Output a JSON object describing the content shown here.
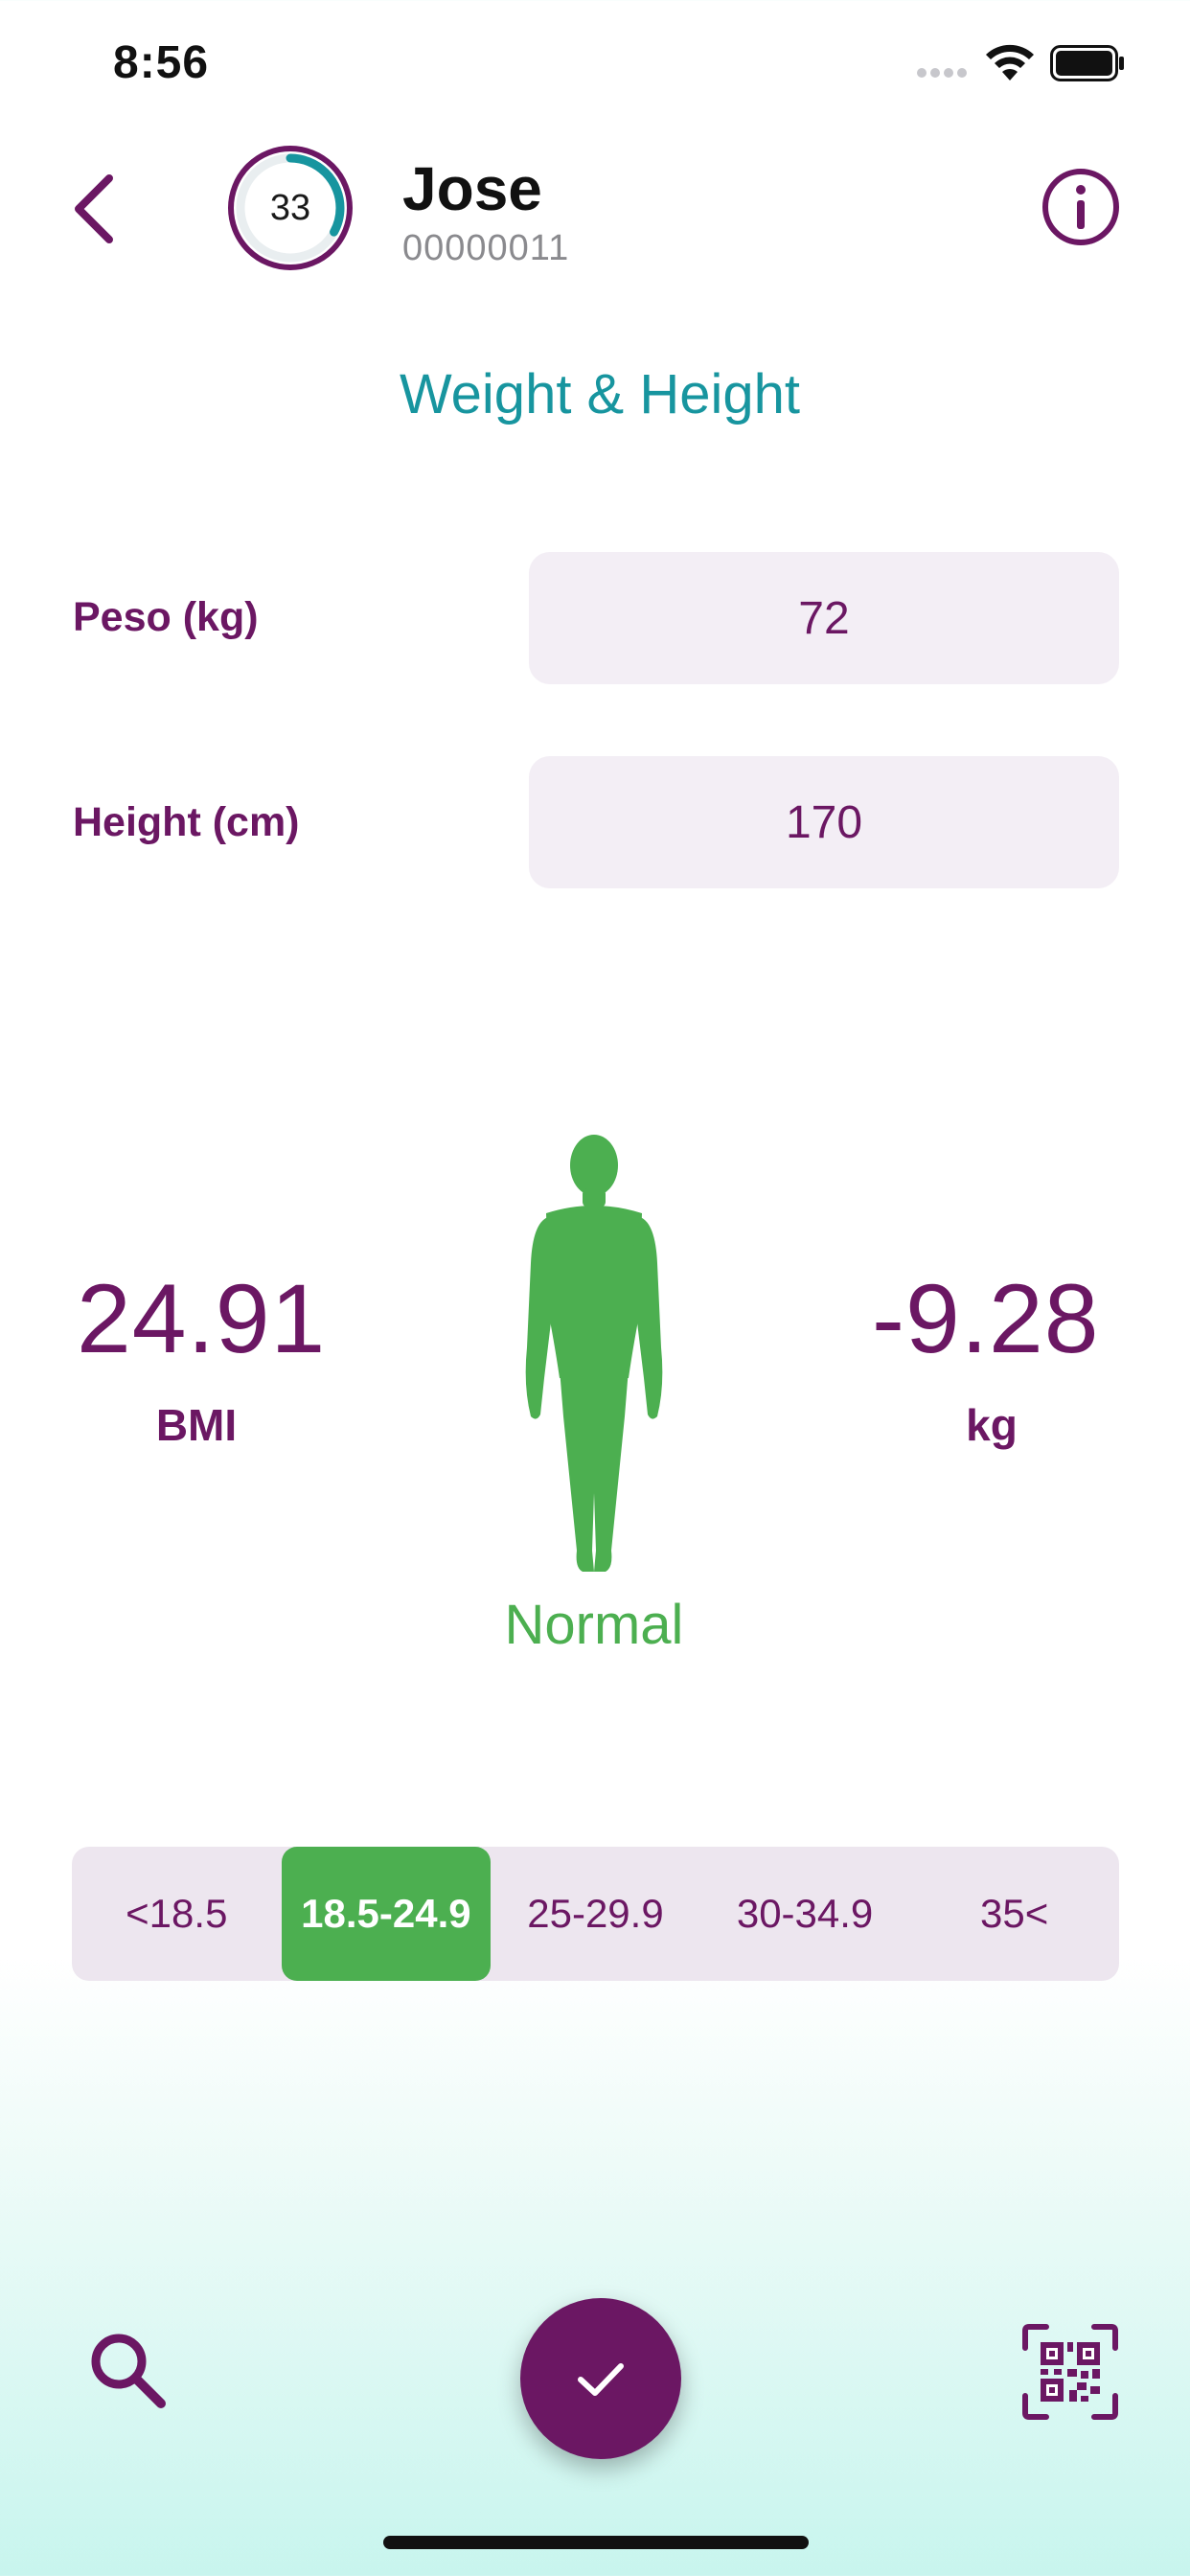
{
  "status_bar": {
    "time": "8:56"
  },
  "header": {
    "score": "33",
    "score_progress": 0.33,
    "patient_name": "Jose",
    "patient_id": "00000011"
  },
  "page": {
    "title": "Weight & Height"
  },
  "form": {
    "weight_label": "Peso (kg)",
    "weight_value": "72",
    "height_label": "Height (cm)",
    "height_value": "170"
  },
  "result": {
    "bmi_value": "24.91",
    "bmi_label": "BMI",
    "weight_diff_value": "-9.28",
    "weight_diff_unit": "kg",
    "category": "Normal"
  },
  "ranges": {
    "items": [
      "<18.5",
      "18.5-24.9",
      "25-29.9",
      "30-34.9",
      "35<"
    ],
    "selected_index": 1
  },
  "colors": {
    "primary": "#6b1763",
    "accent_teal": "#17959f",
    "status_green": "#4caf50",
    "field_bg": "#f3eef5"
  },
  "icons": {
    "back": "chevron-left-icon",
    "info": "info-icon",
    "search": "search-icon",
    "confirm": "checkmark-icon",
    "scan": "qr-code-icon",
    "figure": "human-body-icon"
  }
}
